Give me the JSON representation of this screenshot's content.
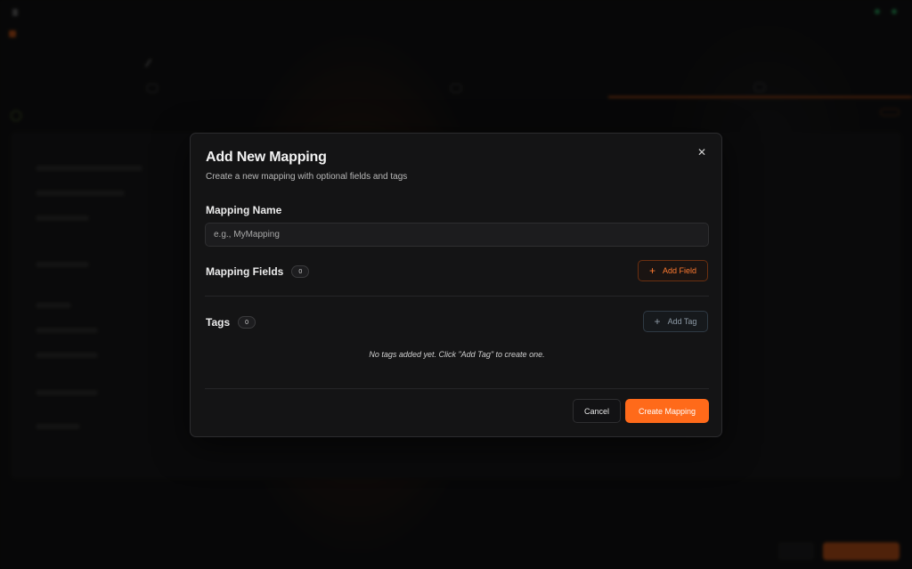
{
  "modal": {
    "title": "Add New Mapping",
    "subtitle": "Create a new mapping with optional fields and tags",
    "close_icon": "close-icon",
    "mapping_name": {
      "label": "Mapping Name",
      "placeholder": "e.g., MyMapping",
      "value": ""
    },
    "mapping_fields": {
      "label": "Mapping Fields",
      "count": "0",
      "add_button_label": "Add Field",
      "add_icon": "plus-icon"
    },
    "tags": {
      "label": "Tags",
      "count": "0",
      "add_button_label": "Add Tag",
      "add_icon": "plus-icon",
      "empty_message": "No tags added yet. Click \"Add Tag\" to create one."
    },
    "footer": {
      "cancel_label": "Cancel",
      "create_label": "Create Mapping"
    }
  },
  "colors": {
    "accent": "#ff6a1a",
    "modal_bg": "#141415",
    "backdrop": "#0b0b0c"
  }
}
